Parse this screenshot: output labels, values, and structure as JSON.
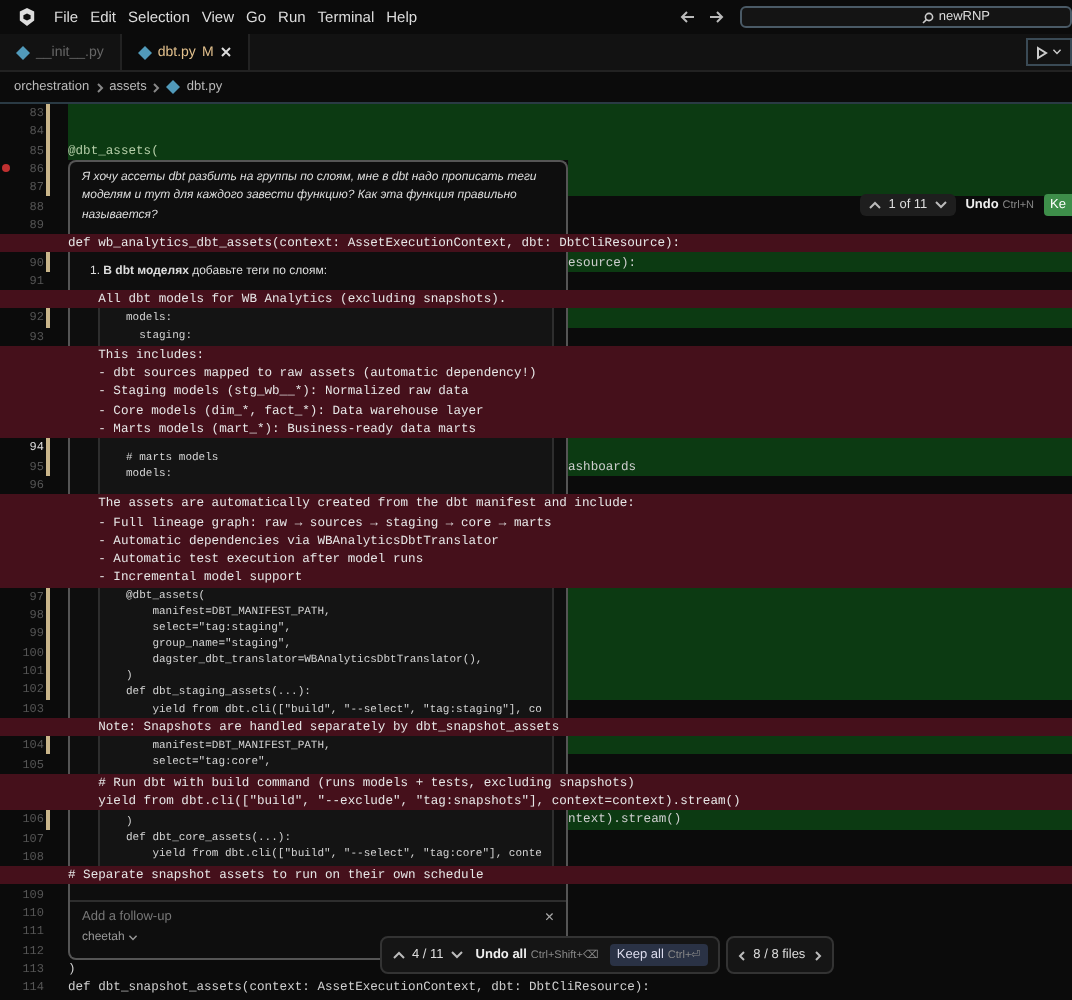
{
  "menu": {
    "items": [
      "File",
      "Edit",
      "Selection",
      "View",
      "Go",
      "Run",
      "Terminal",
      "Help"
    ]
  },
  "search": {
    "value": "newRNP"
  },
  "tabs": [
    {
      "label": "__init__.py",
      "selected": false
    },
    {
      "label": "dbt.py",
      "selected": true,
      "badge": "M"
    }
  ],
  "breadcrumb": [
    "orchestration",
    "assets",
    "dbt.py"
  ],
  "editor": {
    "blocks": [
      {
        "kind": "rows",
        "rows": [
          {
            "line": "83",
            "added": true
          },
          {
            "line": "84",
            "added": true
          },
          {
            "line": "85",
            "added": true,
            "code": "@dbt_assets("
          }
        ]
      },
      {
        "kind": "rows",
        "rows": [
          {
            "line": "86",
            "added": true,
            "breakpoint": true
          },
          {
            "line": "87",
            "added": true
          },
          {
            "line": "88",
            "added": false
          },
          {
            "line": "89",
            "added": false
          }
        ],
        "chat": [
          {
            "kind": "question",
            "lines": [
              "Я хочу ассеты dbt разбить на группы по слоям, мне в dbt надо прописать теги",
              "моделям и тут для каждого завести функцию? Как эта функция правильно",
              "называется?"
            ]
          }
        ]
      },
      {
        "kind": "deleted",
        "lines": [
          "def wb_analytics_dbt_assets(context: AssetExecutionContext, dbt: DbtCliResource):"
        ]
      },
      {
        "kind": "rows",
        "rows": [
          {
            "line": "90",
            "added": true,
            "code": "esource):"
          },
          {
            "line": "91",
            "added": false
          }
        ],
        "chat": [
          {
            "kind": "step",
            "text": "1. **В dbt моделях** добавьте теги по слоям:"
          }
        ]
      },
      {
        "kind": "deleted",
        "lines": [
          "    All dbt models for WB Analytics (excluding snapshots)."
        ]
      },
      {
        "kind": "rows",
        "rows": [
          {
            "line": "92",
            "added": true
          },
          {
            "line": "93",
            "added": false
          }
        ],
        "chat": [
          {
            "kind": "code",
            "lines": [
              "models:",
              "  staging:"
            ]
          }
        ]
      },
      {
        "kind": "deleted",
        "lines": [
          "    This includes:",
          "    - dbt sources mapped to raw assets (automatic dependency!)",
          "    - Staging models (stg_wb__*): Normalized raw data",
          "    - Core models (dim_*, fact_*): Data warehouse layer",
          "    - Marts models (mart_*): Business-ready data marts"
        ]
      },
      {
        "kind": "rows",
        "rows": [
          {
            "line": "94",
            "added": true,
            "current": true
          },
          {
            "line": "95",
            "added": true,
            "code": "ashboards"
          },
          {
            "line": "96",
            "added": false
          }
        ],
        "chat": [
          {
            "kind": "code",
            "lines": [
              "# marts models",
              "models:"
            ]
          }
        ]
      },
      {
        "kind": "deleted",
        "lines": [
          "    The assets are automatically created from the dbt manifest and include:",
          "    - Full lineage graph: raw → sources → staging → core → marts",
          "    - Automatic dependencies via WBAnalyticsDbtTranslator",
          "    - Automatic test execution after model runs",
          "    - Incremental model support"
        ]
      },
      {
        "kind": "rows",
        "rows": [
          {
            "line": "97",
            "added": true
          },
          {
            "line": "98",
            "added": true
          },
          {
            "line": "99",
            "added": true
          },
          {
            "line": "100",
            "added": true
          },
          {
            "line": "101",
            "added": true
          },
          {
            "line": "102",
            "added": true
          },
          {
            "line": "103",
            "added": false
          }
        ],
        "chat": [
          {
            "kind": "code",
            "lines": [
              "@dbt_assets(",
              "    manifest=DBT_MANIFEST_PATH,",
              "    select=\"tag:staging\",",
              "    group_name=\"staging\",",
              "    dagster_dbt_translator=WBAnalyticsDbtTranslator(),",
              ")",
              "def dbt_staging_assets(...):",
              "    yield from dbt.cli([\"build\", \"--select\", \"tag:staging\"], co"
            ]
          }
        ]
      },
      {
        "kind": "deleted",
        "lines": [
          "    Note: Snapshots are handled separately by dbt_snapshot_assets"
        ]
      },
      {
        "kind": "rows",
        "rows": [
          {
            "line": "104",
            "added": true
          },
          {
            "line": "105",
            "added": false
          }
        ],
        "chat": [
          {
            "kind": "code",
            "lines": [
              "    manifest=DBT_MANIFEST_PATH,",
              "    select=\"tag:core\","
            ]
          }
        ]
      },
      {
        "kind": "deleted",
        "lines": [
          "    # Run dbt with build command (runs models + tests, excluding snapshots)",
          "    yield from dbt.cli([\"build\", \"--exclude\", \"tag:snapshots\"], context=context).stream()"
        ]
      },
      {
        "kind": "rows",
        "rows": [
          {
            "line": "106",
            "added": true,
            "code": "ntext).stream()"
          },
          {
            "line": "107",
            "added": false
          },
          {
            "line": "108",
            "added": false
          }
        ],
        "chat": [
          {
            "kind": "code",
            "lines": [
              ")",
              "def dbt_core_assets(...):",
              "    yield from dbt.cli([\"build\", \"--select\", \"tag:core\"], conte"
            ]
          }
        ]
      },
      {
        "kind": "deleted",
        "lines": [
          "# Separate snapshot assets to run on their own schedule"
        ]
      },
      {
        "kind": "rows",
        "rows": [
          {
            "line": "109",
            "added": false
          },
          {
            "line": "110",
            "added": false
          },
          {
            "line": "111",
            "added": false
          },
          {
            "line": "112",
            "added": false
          }
        ],
        "chat": [
          {
            "kind": "input",
            "placeholder": "Add a follow-up",
            "model": "cheetah"
          }
        ]
      },
      {
        "kind": "rows",
        "rows": [
          {
            "line": "113",
            "added": false,
            "code": ")"
          },
          {
            "line": "114",
            "added": false,
            "code": "def dbt_snapshot_assets(context: AssetExecutionContext, dbt: DbtCliResource):"
          }
        ]
      }
    ],
    "hunk_toolbar": {
      "counter": "1 of 11",
      "undo": "Undo",
      "undo_shortcut": "Ctrl+N",
      "keep": "Ke"
    }
  },
  "chat_close": "×",
  "review_bar": {
    "counter": "4 / 11",
    "undo": "Undo all",
    "undo_shortcut": "Ctrl+Shift+⌫",
    "keep": "Keep all",
    "keep_shortcut": "Ctrl+⏎",
    "files": "8 / 8 files"
  }
}
